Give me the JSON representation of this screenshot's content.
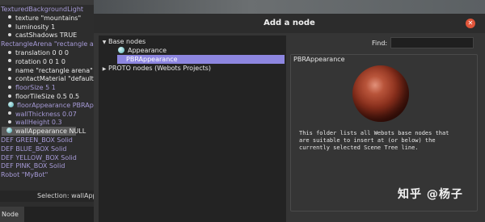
{
  "scene_tree": {
    "top_fragment": "",
    "rows": [
      {
        "text": "TexturedBackgroundLight",
        "color": "purple",
        "marker": "triangle-open"
      },
      {
        "text": "texture \"mountains\"",
        "color": "white",
        "marker": "dot"
      },
      {
        "text": "luminosity 1",
        "color": "white",
        "marker": "dot"
      },
      {
        "text": "castShadows TRUE",
        "color": "white",
        "marker": "dot"
      },
      {
        "text": "RectangleArena \"rectangle arena\"",
        "color": "purple",
        "marker": "triangle-open"
      },
      {
        "text": "translation 0 0 0",
        "color": "white",
        "marker": "dot"
      },
      {
        "text": "rotation 0 0 1 0",
        "color": "white",
        "marker": "dot"
      },
      {
        "text": "name \"rectangle arena\"",
        "color": "white",
        "marker": "dot"
      },
      {
        "text": "contactMaterial \"default\"",
        "color": "white",
        "marker": "dot"
      },
      {
        "text": "floorSize 5 1",
        "color": "purple",
        "marker": "dot"
      },
      {
        "text": "floorTileSize 0.5 0.5",
        "color": "white",
        "marker": "dot"
      },
      {
        "text": "floorAppearance PBRAppearance",
        "color": "purple",
        "marker": "ball"
      },
      {
        "text": "wallThickness 0.07",
        "color": "purple",
        "marker": "dot"
      },
      {
        "text": "wallHeight 0.3",
        "color": "purple",
        "marker": "dot"
      },
      {
        "text": "wallAppearance NULL",
        "color": "white",
        "marker": "ball",
        "selected": true
      },
      {
        "text": "DEF GREEN_BOX Solid",
        "color": "purple",
        "marker": "triangle"
      },
      {
        "text": "DEF BLUE_BOX Solid",
        "color": "purple",
        "marker": "triangle"
      },
      {
        "text": "DEF YELLOW_BOX Solid",
        "color": "purple",
        "marker": "triangle"
      },
      {
        "text": "DEF PINK_BOX Solid",
        "color": "purple",
        "marker": "triangle"
      },
      {
        "text": "Robot \"MyBot\"",
        "color": "purple",
        "marker": "triangle"
      }
    ],
    "status": "Selection: wallAppearance (MFNode)",
    "tab_label": "Node"
  },
  "dialog": {
    "title": "Add a node",
    "close_icon": "close-icon",
    "tree": {
      "base_nodes_label": "Base nodes",
      "appearance_label": "Appearance",
      "pbr_label": "PBRAppearance",
      "proto_label": "PROTO nodes (Webots Projects)"
    },
    "find": {
      "label": "Find:",
      "value": "",
      "placeholder": ""
    },
    "preview": {
      "title": "PBRAppearance",
      "description": "This folder lists all Webots base nodes that\nare suitable to insert at (or below) the\ncurrently selected Scene Tree line."
    }
  },
  "watermark": "知乎 @杨子",
  "colors": {
    "accent_selection": "#8d86e0",
    "close_button": "#e0553a",
    "purple_text": "#a79bd8"
  }
}
